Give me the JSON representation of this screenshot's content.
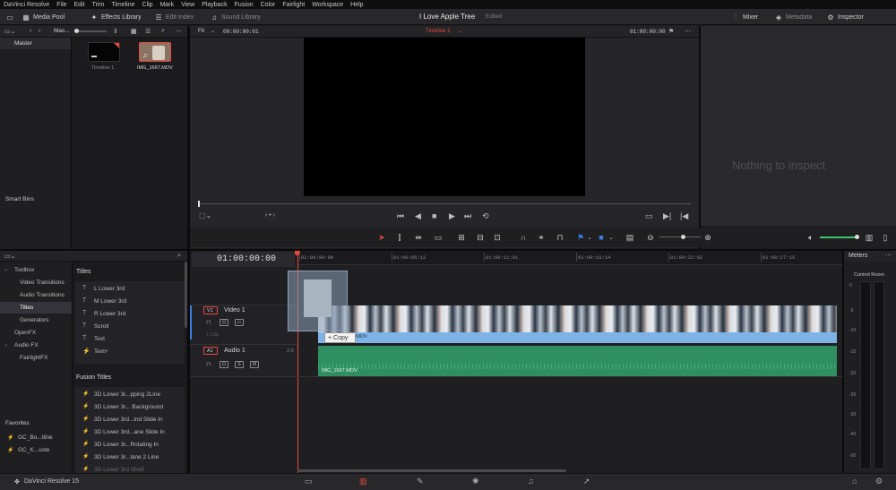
{
  "menu": [
    "DaVinci Resolve",
    "File",
    "Edit",
    "Trim",
    "Timeline",
    "Clip",
    "Mark",
    "View",
    "Playback",
    "Fusion",
    "Color",
    "Fairlight",
    "Workspace",
    "Help"
  ],
  "toolbar": {
    "media_pool": "Media Pool",
    "effects_library": "Effects Library",
    "edit_index": "Edit Index",
    "sound_library": "Sound Library",
    "project_title": "I Love Apple Tree",
    "project_state": "Edited",
    "mixer": "Mixer",
    "metadata": "Metadata",
    "inspector": "Inspector"
  },
  "media_pool": {
    "bin_dropdown": "Mas...",
    "bins": {
      "master": "Master",
      "smart_bins": "Smart Bins"
    },
    "clips": [
      {
        "name": "Timeline 1",
        "icon": "timeline-icon"
      },
      {
        "name": "IMG_1667.MOV",
        "icon": "audio-note-icon"
      }
    ]
  },
  "viewer": {
    "zoom": "Fit",
    "source_timecode": "00:00:00:01",
    "timeline_name": "Timeline 1",
    "record_timecode": "01:00:00:00"
  },
  "inspector": {
    "empty_message": "Nothing to inspect"
  },
  "effects": {
    "tree": [
      {
        "label": "Toolbox",
        "indent": 0,
        "expanded": true
      },
      {
        "label": "Video Transitions",
        "indent": 1
      },
      {
        "label": "Audio Transitions",
        "indent": 1
      },
      {
        "label": "Titles",
        "indent": 1,
        "selected": true
      },
      {
        "label": "Generators",
        "indent": 1
      },
      {
        "label": "OpenFX",
        "indent": 0
      },
      {
        "label": "Audio FX",
        "indent": 0,
        "expanded": true
      },
      {
        "label": "FairlightFX",
        "indent": 1
      }
    ],
    "favorites_header": "Favorites",
    "favorites": [
      "GC_Bo...tline",
      "GC_K...uste"
    ],
    "titles_header": "Titles",
    "titles": [
      {
        "label": "L Lower 3rd",
        "glyph": "T"
      },
      {
        "label": "M Lower 3rd",
        "glyph": "T"
      },
      {
        "label": "R Lower 3rd",
        "glyph": "T"
      },
      {
        "label": "Scroll",
        "glyph": "T"
      },
      {
        "label": "Text",
        "glyph": "T"
      },
      {
        "label": "Text+",
        "glyph": "⚡"
      }
    ],
    "fusion_header": "Fusion Titles",
    "fusion_titles": [
      "3D Lower 3r...pping 2Line",
      "3D Lower 3r... Background",
      "3D Lower 3rd...ind Slide In",
      "3D Lower 3rd...ane Slide In",
      "3D Lower 3r...Rotating In",
      "3D Lower 3r...lane 2 Line",
      "3D Lower 3rd Shelf"
    ]
  },
  "timeline": {
    "timecode": "01:00:00:00",
    "ruler": [
      "01:00:00:00",
      "01:00:05:12",
      "01:00:11:01",
      "01:00:16:14",
      "01:00:22:02",
      "01:00:27:15"
    ],
    "video_track": {
      "id": "V1",
      "name": "Video 1",
      "clip_count": "1 Clip",
      "clip_name": "IMG_1667.MOV"
    },
    "audio_track": {
      "id": "A1",
      "name": "Audio 1",
      "level": "2.0",
      "clip_name": "IMG_1667.MOV"
    },
    "drag_tooltip": "+ Copy"
  },
  "meters": {
    "title": "Meters",
    "control_room": "Control Room",
    "scale": [
      "0",
      "-5",
      "-10",
      "-15",
      "-20",
      "-25",
      "-30",
      "-40",
      "-50"
    ]
  },
  "bottom": {
    "app_name": "DaVinci Resolve 15"
  },
  "colors": {
    "accent_red": "#e8483b",
    "video_clip": "#7db3e6",
    "audio_clip": "#2f8f60",
    "volume_green": "#3fc46a"
  }
}
